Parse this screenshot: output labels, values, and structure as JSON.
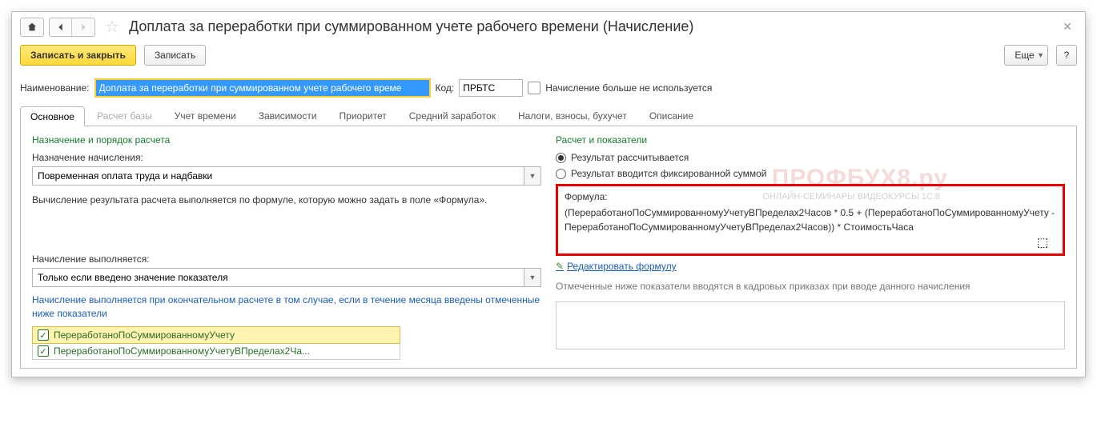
{
  "header": {
    "title": "Доплата за переработки при суммированном учете рабочего времени (Начисление)"
  },
  "toolbar": {
    "save_close": "Записать и закрыть",
    "save": "Записать",
    "more": "Еще",
    "help": "?"
  },
  "fields": {
    "name_label": "Наименование:",
    "name_value": "Доплата за переработки при суммированном учете рабочего време",
    "code_label": "Код:",
    "code_value": "ПРБТС",
    "disabled_label": "Начисление больше не используется"
  },
  "tabs": [
    {
      "label": "Основное",
      "active": true
    },
    {
      "label": "Расчет базы",
      "dim": true
    },
    {
      "label": "Учет времени"
    },
    {
      "label": "Зависимости"
    },
    {
      "label": "Приоритет"
    },
    {
      "label": "Средний заработок"
    },
    {
      "label": "Налоги, взносы, бухучет"
    },
    {
      "label": "Описание"
    }
  ],
  "left": {
    "section": "Назначение и порядок расчета",
    "assign_label": "Назначение начисления:",
    "assign_value": "Повременная оплата труда и надбавки",
    "desc": "Вычисление результата расчета выполняется по формуле, которую можно задать в поле «Формула».",
    "exec_label": "Начисление выполняется:",
    "exec_value": "Только если введено значение показателя",
    "note": "Начисление выполняется при окончательном расчете в том случае, если в течение месяца введены отмеченные ниже показатели",
    "chk1": "ПереработаноПоСуммированномуУчету",
    "chk2": "ПереработаноПоСуммированномуУчетуВПределах2Ча..."
  },
  "right": {
    "section": "Расчет и показатели",
    "radio1": "Результат рассчитывается",
    "radio2": "Результат вводится фиксированной суммой",
    "formula_label": "Формула:",
    "formula_text": "(ПереработаноПоСуммированномуУчетуВПределах2Часов * 0.5 + (ПереработаноПоСуммированномуУчету - ПереработаноПоСуммированномуУчетуВПределах2Часов)) * СтоимостьЧаса",
    "edit": "Редактировать формулу",
    "note": "Отмеченные ниже показатели вводятся в кадровых приказах при вводе данного начисления"
  },
  "watermark": {
    "main": "ПРОФБУХ8.ру",
    "sub": "ОНЛАЙН-СЕМИНАРЫ   ВИДЕОКУРСЫ 1С:8"
  }
}
